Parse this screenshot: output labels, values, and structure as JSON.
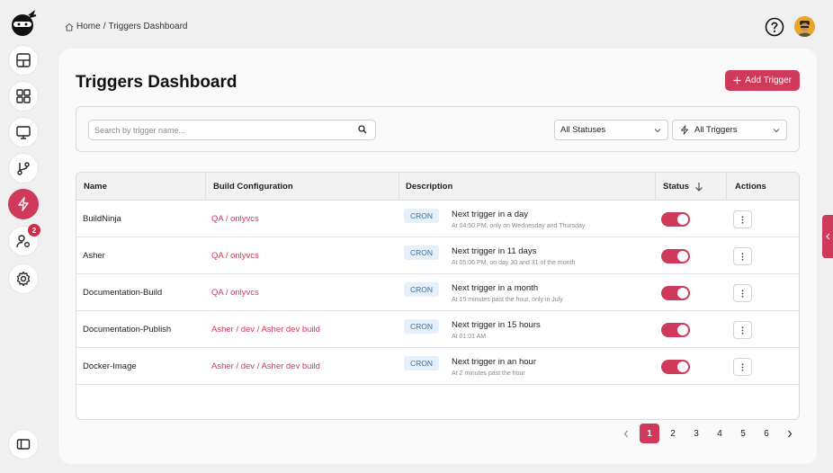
{
  "breadcrumb": {
    "home": "Home",
    "separator": "/",
    "current": "Triggers Dashboard"
  },
  "page": {
    "title": "Triggers Dashboard",
    "add_button": "Add Trigger"
  },
  "filters": {
    "search_placeholder": "Search by trigger name...",
    "status_select": "All Statuses",
    "trigger_select": "All Triggers"
  },
  "nav": {
    "users_badge": "2"
  },
  "table": {
    "headers": {
      "name": "Name",
      "build": "Build Configuration",
      "description": "Description",
      "status": "Status",
      "actions": "Actions"
    },
    "rows": [
      {
        "name": "BuildNinja",
        "build": "QA / onlyvcs",
        "type": "CRON",
        "next": "Next trigger in a day",
        "schedule": "At 04:50 PM, only on Wednesday and Thursday",
        "enabled": true
      },
      {
        "name": "Asher",
        "build": "QA / onlyvcs",
        "type": "CRON",
        "next": "Next trigger in 11 days",
        "schedule": "At 05:06 PM, on day 30 and 31 of the month",
        "enabled": true
      },
      {
        "name": "Documentation-Build",
        "build": "QA / onlyvcs",
        "type": "CRON",
        "next": "Next trigger in a month",
        "schedule": "At 15 minutes past the hour, only in July",
        "enabled": true
      },
      {
        "name": "Documentation-Publish",
        "build": "Asher / dev / Asher dev build",
        "type": "CRON",
        "next": "Next trigger in 15 hours",
        "schedule": "At 01:01 AM",
        "enabled": true
      },
      {
        "name": "Docker-Image",
        "build": "Asher / dev / Asher dev build",
        "type": "CRON",
        "next": "Next trigger in an hour",
        "schedule": "At 2 minutes past the hour",
        "enabled": true
      }
    ]
  },
  "pagination": {
    "pages": [
      "1",
      "2",
      "3",
      "4",
      "5",
      "6"
    ],
    "current": "1"
  },
  "colors": {
    "accent": "#cf3a5a",
    "background": "#f1f0f1",
    "card": "#fafafa"
  }
}
